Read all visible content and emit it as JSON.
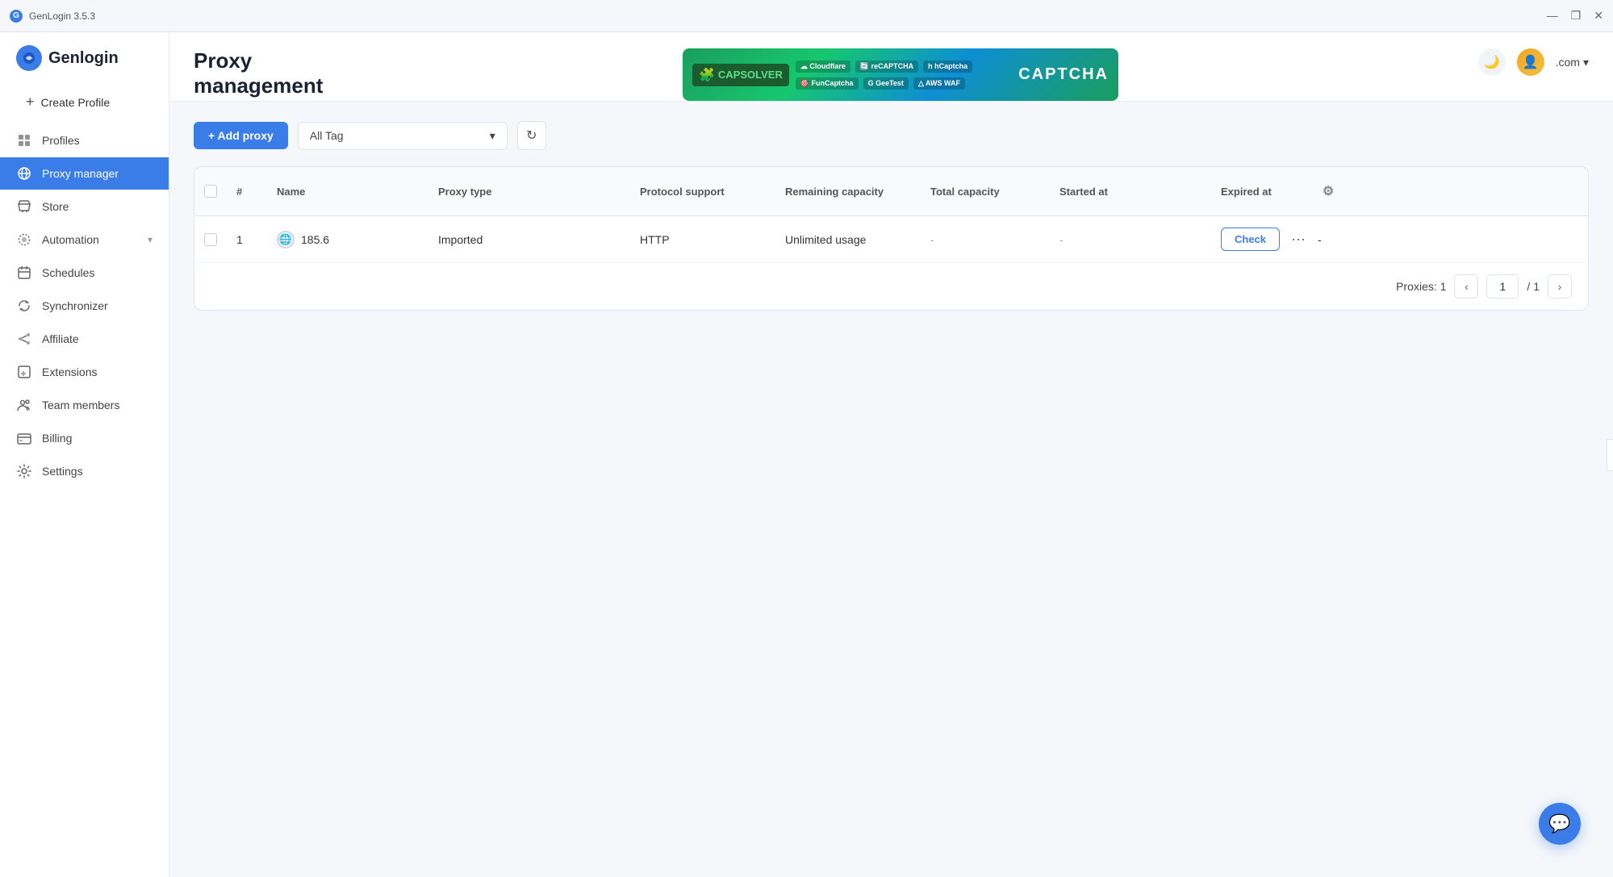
{
  "app": {
    "title": "GenLogin 3.5.3",
    "logo_text": "Genlogin",
    "version": "3.5.3"
  },
  "window_controls": {
    "minimize": "—",
    "restore": "❐",
    "close": "✕"
  },
  "sidebar": {
    "create_label": "Create Profile",
    "items": [
      {
        "id": "profiles",
        "label": "Profiles",
        "icon": "⊞"
      },
      {
        "id": "proxy-manager",
        "label": "Proxy manager",
        "icon": "🖧",
        "active": true
      },
      {
        "id": "store",
        "label": "Store",
        "icon": "🛒"
      },
      {
        "id": "automation",
        "label": "Automation",
        "icon": "⚙",
        "has_chevron": true
      },
      {
        "id": "schedules",
        "label": "Schedules",
        "icon": "📅"
      },
      {
        "id": "synchronizer",
        "label": "Synchronizer",
        "icon": "🔄"
      },
      {
        "id": "affiliate",
        "label": "Affiliate",
        "icon": "🔗"
      },
      {
        "id": "extensions",
        "label": "Extensions",
        "icon": "🧩"
      },
      {
        "id": "team-members",
        "label": "Team members",
        "icon": "👥"
      },
      {
        "id": "billing",
        "label": "Billing",
        "icon": "💳"
      },
      {
        "id": "settings",
        "label": "Settings",
        "icon": "⚙"
      }
    ]
  },
  "header": {
    "page_title": "Proxy",
    "page_subtitle": "management",
    "banner_alt": "Capsolver advertisement banner",
    "domain_label": ".com",
    "dark_mode_icon": "🌙",
    "avatar_icon": "👤"
  },
  "toolbar": {
    "add_proxy_label": "+ Add proxy",
    "tag_dropdown_placeholder": "All Tag",
    "refresh_icon": "↻"
  },
  "table": {
    "columns": [
      {
        "id": "checkbox",
        "label": ""
      },
      {
        "id": "number",
        "label": "#"
      },
      {
        "id": "name",
        "label": "Name"
      },
      {
        "id": "proxy_type",
        "label": "Proxy type"
      },
      {
        "id": "protocol_support",
        "label": "Protocol support"
      },
      {
        "id": "remaining_capacity",
        "label": "Remaining capacity"
      },
      {
        "id": "total_capacity",
        "label": "Total capacity"
      },
      {
        "id": "started_at",
        "label": "Started at"
      },
      {
        "id": "expired_at",
        "label": "Expired at"
      },
      {
        "id": "settings",
        "label": ""
      }
    ],
    "rows": [
      {
        "number": "1",
        "name": "185.6",
        "proxy_type": "Imported",
        "protocol_support": "HTTP",
        "remaining_capacity": "Unlimited usage",
        "total_capacity": "-",
        "started_at": "-",
        "expired_at": "-"
      }
    ]
  },
  "pagination": {
    "proxies_label": "Proxies: 1",
    "current_page": "1",
    "total_pages": "/ 1"
  },
  "actions": {
    "check_button": "Check",
    "more_button": "•••"
  },
  "chat_button_icon": "💬"
}
